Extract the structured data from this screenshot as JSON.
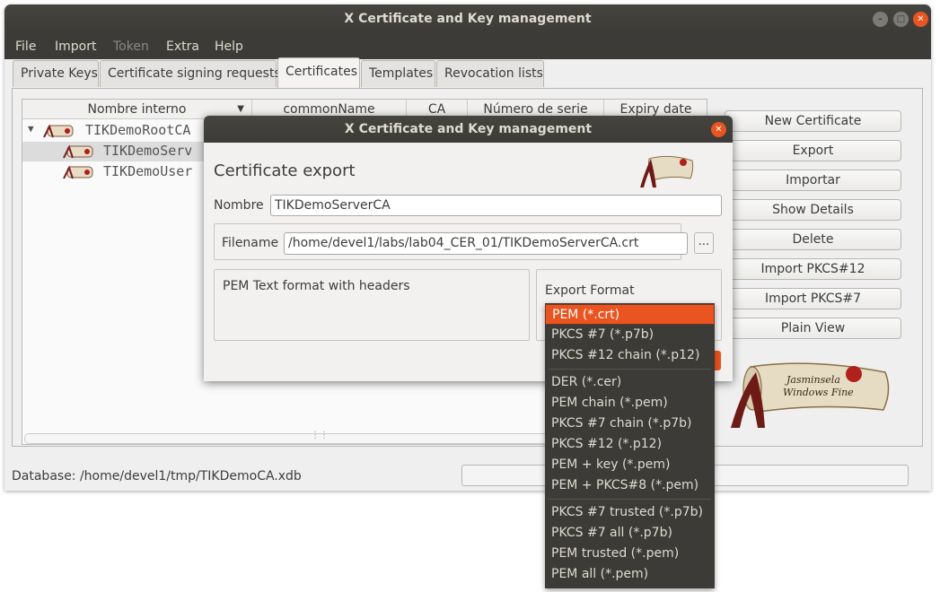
{
  "window": {
    "title": "X Certificate and Key management"
  },
  "menu": [
    "File",
    "Import",
    "Token",
    "Extra",
    "Help"
  ],
  "tabs": [
    "Private Keys",
    "Certificate signing requests",
    "Certificates",
    "Templates",
    "Revocation lists"
  ],
  "tree": {
    "columns": [
      "Nombre interno",
      "commonName",
      "CA",
      "Número de serie",
      "Expiry date"
    ],
    "rows": [
      "TIKDemoRootCA",
      "TIKDemoServ",
      "TIKDemoUser"
    ]
  },
  "buttons": [
    "New Certificate",
    "Export",
    "Importar",
    "Show Details",
    "Delete",
    "Import PKCS#12",
    "Import PKCS#7",
    "Plain View"
  ],
  "status": {
    "database": "Database: /home/devel1/tmp/TIKDemoCA.xdb"
  },
  "dialog": {
    "title": "X Certificate and Key management",
    "heading": "Certificate export",
    "name_label": "Nombre",
    "name_value": "TIKDemoServerCA",
    "filename_label": "Filename",
    "filename_value": "/home/devel1/labs/lab04_CER_01/TIKDemoServerCA.crt",
    "browse_label": "...",
    "description": "PEM Text format with headers",
    "format_label": "Export Format"
  },
  "dropdown": {
    "options": [
      "PEM (*.crt)",
      "PKCS #7 (*.p7b)",
      "PKCS #12 chain (*.p12)",
      "DER (*.cer)",
      "PEM chain (*.pem)",
      "PKCS #7 chain (*.p7b)",
      "PKCS #12 (*.p12)",
      "PEM + key (*.pem)",
      "PEM + PKCS#8 (*.pem)",
      "PKCS #7 trusted (*.p7b)",
      "PKCS #7 all (*.p7b)",
      "PEM trusted (*.pem)",
      "PEM all (*.pem)"
    ],
    "selected": "PEM (*.crt)"
  },
  "colors": {
    "accent": "#e95420",
    "titlebar": "#3c3b37"
  }
}
